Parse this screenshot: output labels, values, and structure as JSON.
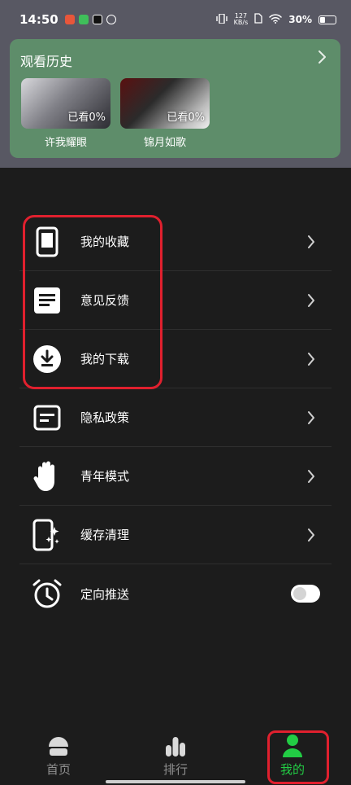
{
  "status_bar": {
    "time": "14:50",
    "net_speed_top": "127",
    "net_speed_bottom": "KB/s",
    "battery": "30%"
  },
  "history": {
    "title": "观看历史",
    "items": [
      {
        "name": "许我耀眼",
        "progress": "已看0%"
      },
      {
        "name": "锦月如歌",
        "progress": "已看0%"
      }
    ]
  },
  "menu": {
    "items": [
      {
        "label": "我的收藏",
        "icon": "phone-frame-icon"
      },
      {
        "label": "意见反馈",
        "icon": "document-lines-icon"
      },
      {
        "label": "我的下载",
        "icon": "download-circle-icon"
      },
      {
        "label": "隐私政策",
        "icon": "policy-card-icon"
      },
      {
        "label": "青年模式",
        "icon": "hand-icon"
      },
      {
        "label": "缓存清理",
        "icon": "phone-sparkle-icon"
      },
      {
        "label": "定向推送",
        "icon": "alarm-clock-icon",
        "toggle": "off"
      }
    ]
  },
  "bottom_nav": {
    "items": [
      {
        "label": "首页",
        "icon": "home-cap-icon",
        "active": false
      },
      {
        "label": "排行",
        "icon": "bar-chart-icon",
        "active": false
      },
      {
        "label": "我的",
        "icon": "person-icon",
        "active": true
      }
    ]
  },
  "colors": {
    "accent": "#22cc44",
    "highlight": "#e0202e",
    "card": "#5e8d6a",
    "background": "#1c1c1c"
  }
}
